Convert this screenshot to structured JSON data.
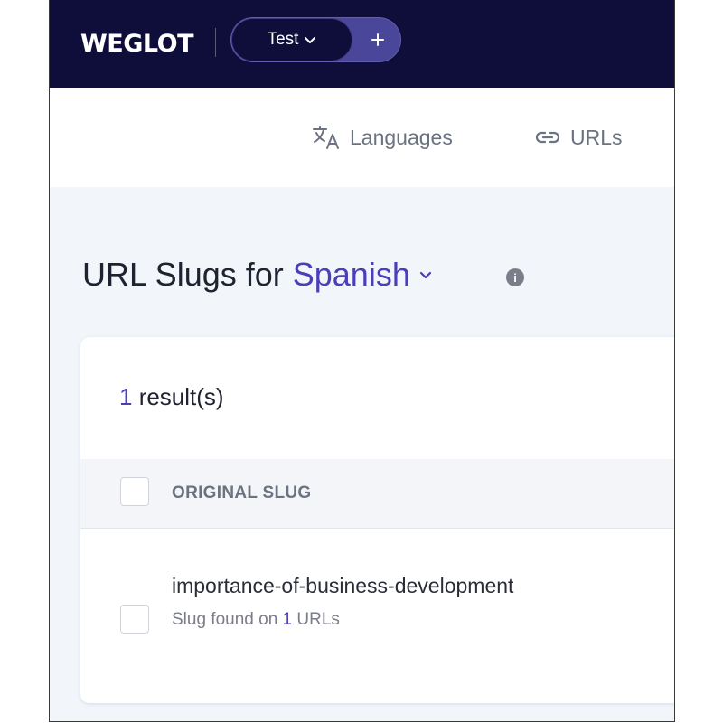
{
  "header": {
    "logo_text": "WEGLOT",
    "project_name": "Test",
    "add_label": "+"
  },
  "nav": {
    "languages_label": "Languages",
    "urls_label": "URLs"
  },
  "title": {
    "prefix": "URL Slugs for",
    "language": "Spanish",
    "info_glyph": "i"
  },
  "results": {
    "count": "1",
    "suffix": " result(s)"
  },
  "table": {
    "column_header": "ORIGINAL SLUG",
    "rows": [
      {
        "slug": "importance-of-business-development",
        "meta_prefix": "Slug found on ",
        "meta_count": "1",
        "meta_suffix": " URLs"
      }
    ]
  },
  "colors": {
    "topbar_bg": "#0f0d3a",
    "accent": "#4a3fb8",
    "page_bg": "#f2f5fa"
  },
  "icons": [
    "translate-icon",
    "link-icon",
    "chevron-down-icon",
    "plus-icon",
    "info-icon"
  ]
}
